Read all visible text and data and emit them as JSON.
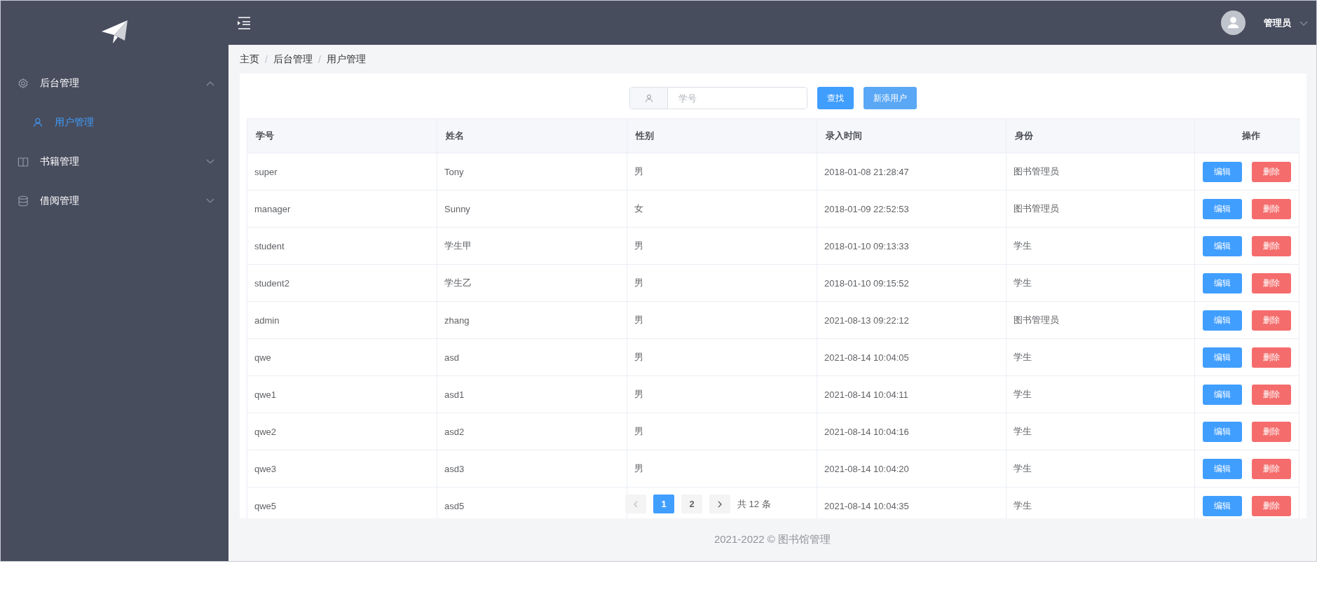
{
  "sidebar": {
    "menu": [
      {
        "label": "后台管理",
        "kind": "gear",
        "expanded": true,
        "children": [
          {
            "label": "用户管理",
            "kind": "user",
            "selected": true
          }
        ]
      },
      {
        "label": "书籍管理",
        "kind": "book",
        "expanded": false
      },
      {
        "label": "借阅管理",
        "kind": "database",
        "expanded": false
      }
    ]
  },
  "header": {
    "user": "管理员"
  },
  "breadcrumb": [
    "主页",
    "/",
    "后台管理",
    "/",
    "用户管理"
  ],
  "search": {
    "placeholder": "学号"
  },
  "toolbar_buttons": [
    "查找",
    "新添用户"
  ],
  "table": {
    "columns": [
      "学号",
      "姓名",
      "性别",
      "录入时间",
      "身份",
      "操作"
    ],
    "rows": [
      {
        "id": "super",
        "name": "Tony",
        "gender": "男",
        "time": "2018-01-08 21:28:47",
        "role": "图书管理员",
        "actions": [
          {
            "label": "编辑",
            "kind": "edit"
          },
          {
            "label": "删除",
            "kind": "delete"
          }
        ]
      },
      {
        "id": "manager",
        "name": "Sunny",
        "gender": "女",
        "time": "2018-01-09 22:52:53",
        "role": "图书管理员",
        "actions": [
          {
            "label": "编辑",
            "kind": "edit"
          },
          {
            "label": "删除",
            "kind": "delete"
          }
        ]
      },
      {
        "id": "student",
        "name": "学生甲",
        "gender": "男",
        "time": "2018-01-10 09:13:33",
        "role": "学生",
        "actions": [
          {
            "label": "编辑",
            "kind": "edit"
          },
          {
            "label": "删除",
            "kind": "delete"
          }
        ]
      },
      {
        "id": "student2",
        "name": "学生乙",
        "gender": "男",
        "time": "2018-01-10 09:15:52",
        "role": "学生",
        "actions": [
          {
            "label": "编辑",
            "kind": "edit"
          },
          {
            "label": "删除",
            "kind": "delete"
          }
        ]
      },
      {
        "id": "admin",
        "name": "zhang",
        "gender": "男",
        "time": "2021-08-13 09:22:12",
        "role": "图书管理员",
        "actions": [
          {
            "label": "编辑",
            "kind": "edit"
          },
          {
            "label": "删除",
            "kind": "delete"
          }
        ]
      },
      {
        "id": "qwe",
        "name": "asd",
        "gender": "男",
        "time": "2021-08-14 10:04:05",
        "role": "学生",
        "actions": [
          {
            "label": "编辑",
            "kind": "edit"
          },
          {
            "label": "删除",
            "kind": "delete"
          }
        ]
      },
      {
        "id": "qwe1",
        "name": "asd1",
        "gender": "男",
        "time": "2021-08-14 10:04:11",
        "role": "学生",
        "actions": [
          {
            "label": "编辑",
            "kind": "edit"
          },
          {
            "label": "删除",
            "kind": "delete"
          }
        ]
      },
      {
        "id": "qwe2",
        "name": "asd2",
        "gender": "男",
        "time": "2021-08-14 10:04:16",
        "role": "学生",
        "actions": [
          {
            "label": "编辑",
            "kind": "edit"
          },
          {
            "label": "删除",
            "kind": "delete"
          }
        ]
      },
      {
        "id": "qwe3",
        "name": "asd3",
        "gender": "男",
        "time": "2021-08-14 10:04:20",
        "role": "学生",
        "actions": [
          {
            "label": "编辑",
            "kind": "edit"
          },
          {
            "label": "删除",
            "kind": "delete"
          }
        ]
      },
      {
        "id": "qwe5",
        "name": "asd5",
        "time": "2021-08-14 10:04:35",
        "role": "学生",
        "actions": [
          {
            "label": "编辑",
            "kind": "edit"
          },
          {
            "label": "删除",
            "kind": "delete"
          }
        ]
      }
    ]
  },
  "pagination": {
    "pages": [
      {
        "label": "1",
        "selected": true
      },
      {
        "label": "2",
        "selected": false
      }
    ],
    "total": "共 12 条"
  },
  "footer": "2021-2022 © 图书馆管理"
}
